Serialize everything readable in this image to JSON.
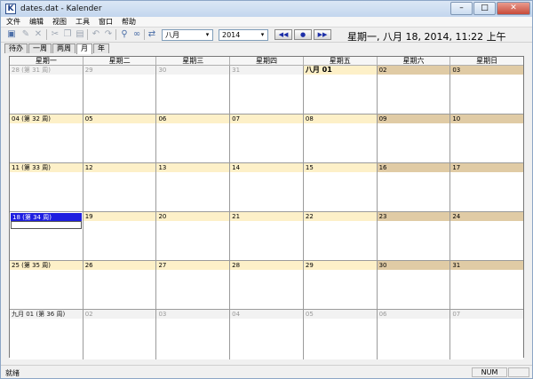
{
  "window": {
    "title": "dates.dat - Kalender",
    "min": "–",
    "max": "□",
    "close": "✕"
  },
  "menu": [
    "文件",
    "编辑",
    "视图",
    "工具",
    "窗口",
    "帮助"
  ],
  "toolbar": {
    "month": "八月",
    "year": "2014",
    "prev": "◀◀",
    "today": "●",
    "next": "▶▶",
    "combo_arrow": "▾"
  },
  "current_datetime": "星期一, 八月 18, 2014, 11:22 上午",
  "tabs": [
    {
      "label": "待办"
    },
    {
      "label": "一周"
    },
    {
      "label": "两周"
    },
    {
      "label": "月"
    },
    {
      "label": "年"
    }
  ],
  "weekdays": [
    "星期一",
    "星期二",
    "星期三",
    "星期四",
    "星期五",
    "星期六",
    "星期日"
  ],
  "weeks": [
    {
      "cells": [
        "28 (第 31 周)",
        "29",
        "30",
        "31",
        "八月 01",
        "02",
        "03"
      ]
    },
    {
      "cells": [
        "04 (第 32 周)",
        "05",
        "06",
        "07",
        "08",
        "09",
        "10"
      ]
    },
    {
      "cells": [
        "11 (第 33 周)",
        "12",
        "13",
        "14",
        "15",
        "16",
        "17"
      ]
    },
    {
      "cells": [
        "18 (第 34 周)",
        "19",
        "20",
        "21",
        "22",
        "23",
        "24"
      ]
    },
    {
      "cells": [
        "25 (第 35 周)",
        "26",
        "27",
        "28",
        "29",
        "30",
        "31"
      ]
    },
    {
      "cells": [
        "九月 01 (第 36 周)",
        "02",
        "03",
        "04",
        "05",
        "06",
        "07"
      ]
    }
  ],
  "status": {
    "text": "就绪",
    "num": "NUM"
  }
}
